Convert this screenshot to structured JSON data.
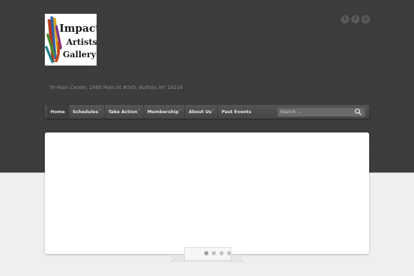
{
  "header": {
    "logo": {
      "alt": "Impact Artists Gallery logo",
      "line1": "Impact",
      "line2": "Artists",
      "line3": "Gallery"
    },
    "social": [
      {
        "name": "twitter",
        "glyph": "t"
      },
      {
        "name": "facebook",
        "glyph": "f"
      },
      {
        "name": "rss",
        "glyph": "≡"
      }
    ],
    "address": "Tri-Main Center, 2495 Main St #545, Buffalo, NY 14214"
  },
  "nav": {
    "items": [
      {
        "label": "Home",
        "dropdown": false
      },
      {
        "label": "Schedules",
        "dropdown": true
      },
      {
        "label": "Take Action",
        "dropdown": true
      },
      {
        "label": "Membership",
        "dropdown": true
      },
      {
        "label": "About Us",
        "dropdown": true
      },
      {
        "label": "Past Events",
        "dropdown": false
      }
    ],
    "caret": "˅",
    "search": {
      "placeholder": "Search ..."
    }
  },
  "slider": {
    "dot_count": 4,
    "active_index": 0
  },
  "colors": {
    "header_bg": "#3b3b3b",
    "page_bg": "#efefef",
    "nav_bg": "#4e4e4e",
    "panel_bg": "#ffffff"
  }
}
